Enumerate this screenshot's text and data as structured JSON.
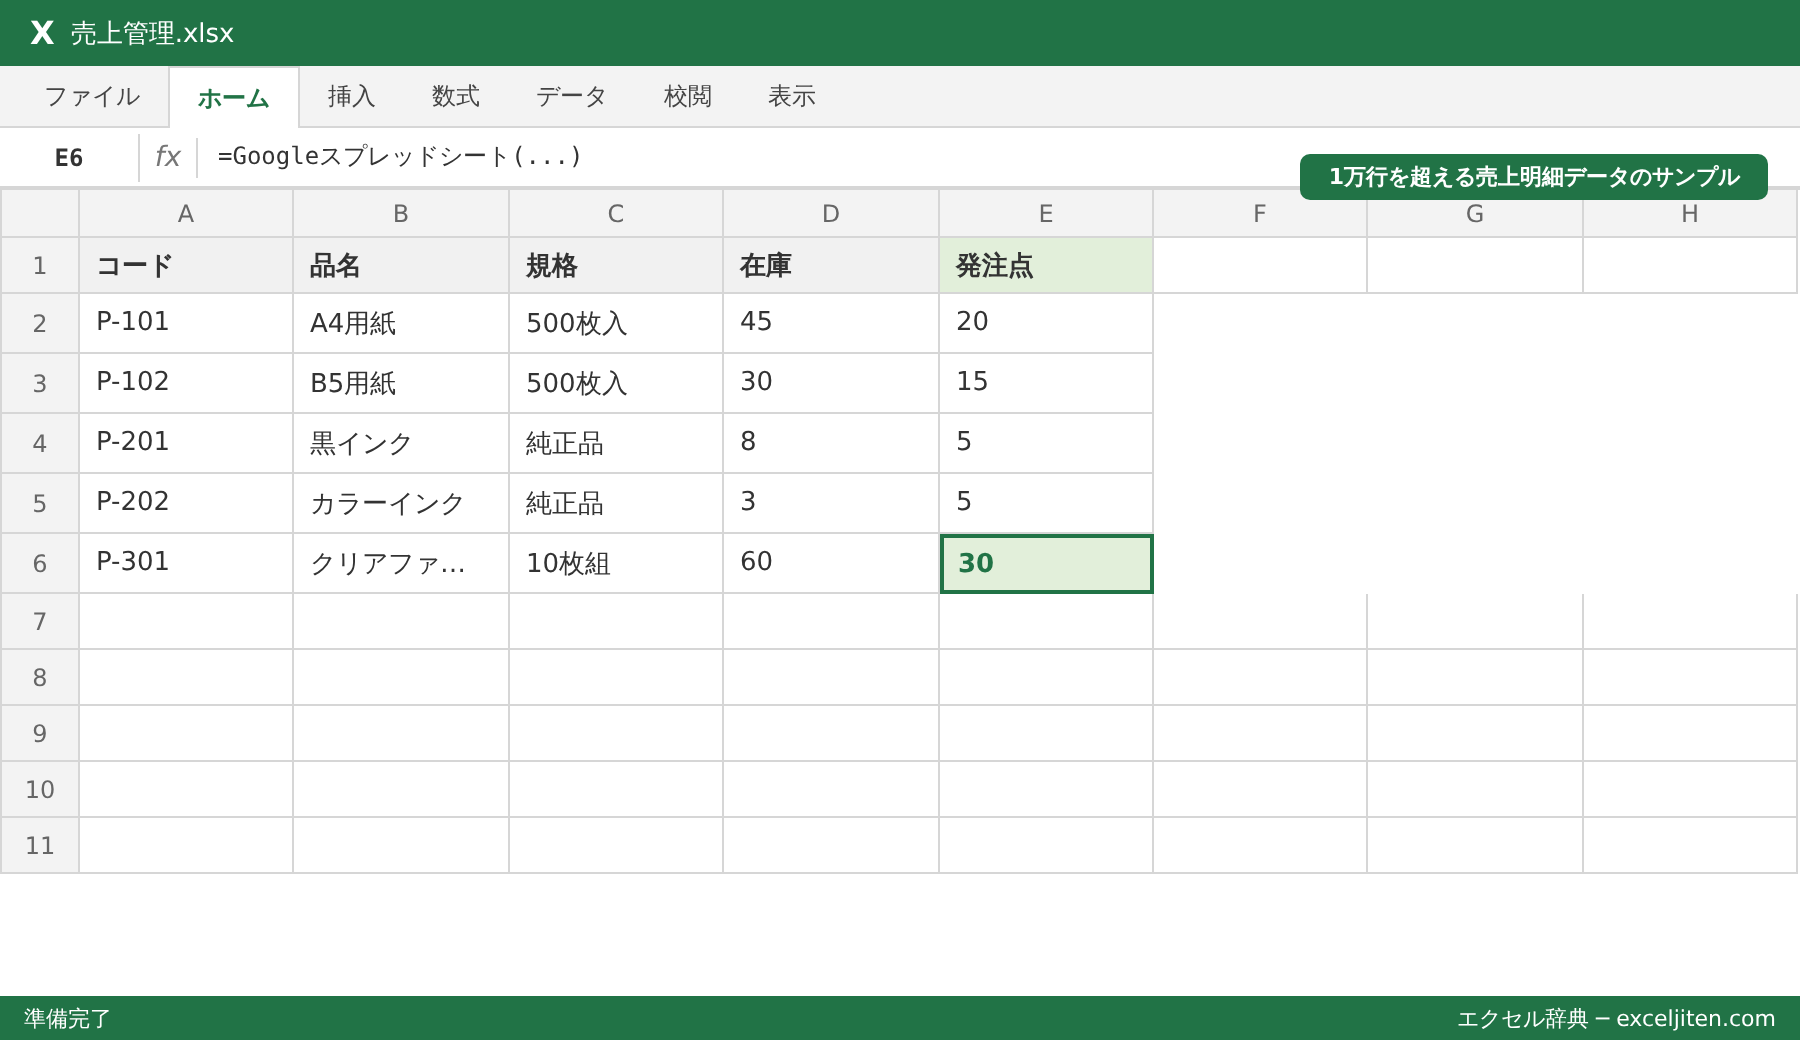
{
  "window": {
    "app_icon": "X",
    "title": "売上管理.xlsx"
  },
  "tabs": [
    {
      "label": "ファイル",
      "selected": false
    },
    {
      "label": "ホーム",
      "selected": true
    },
    {
      "label": "挿入",
      "selected": false
    },
    {
      "label": "数式",
      "selected": false
    },
    {
      "label": "データ",
      "selected": false
    },
    {
      "label": "校閲",
      "selected": false
    },
    {
      "label": "表示",
      "selected": false
    }
  ],
  "formula_bar": {
    "name_box": "E6",
    "fx": "fx",
    "formula": "=Googleスプレッドシート(...)"
  },
  "callout": "1万行を超える売上明細データのサンプル",
  "columns": [
    "A",
    "B",
    "C",
    "D",
    "E",
    "F",
    "G",
    "H"
  ],
  "rows": [
    {
      "number": "1",
      "kind": "header",
      "cells": [
        {
          "text": "コード",
          "highlighted": false,
          "selected": false
        },
        {
          "text": "品名",
          "highlighted": false,
          "selected": false
        },
        {
          "text": "規格",
          "highlighted": false,
          "selected": false
        },
        {
          "text": "在庫",
          "highlighted": false,
          "selected": false
        },
        {
          "text": "発注点",
          "highlighted": true,
          "selected": false
        }
      ]
    },
    {
      "number": "2",
      "kind": "data",
      "cells": [
        {
          "text": "P-101",
          "selected": false
        },
        {
          "text": "A4用紙",
          "selected": false
        },
        {
          "text": "500枚入",
          "selected": false
        },
        {
          "text": "45",
          "selected": false
        },
        {
          "text": "20",
          "selected": false
        }
      ]
    },
    {
      "number": "3",
      "kind": "data",
      "cells": [
        {
          "text": "P-102",
          "selected": false
        },
        {
          "text": "B5用紙",
          "selected": false
        },
        {
          "text": "500枚入",
          "selected": false
        },
        {
          "text": "30",
          "selected": false
        },
        {
          "text": "15",
          "selected": false
        }
      ]
    },
    {
      "number": "4",
      "kind": "data",
      "cells": [
        {
          "text": "P-201",
          "selected": false
        },
        {
          "text": "黒インク",
          "selected": false
        },
        {
          "text": "純正品",
          "selected": false
        },
        {
          "text": "8",
          "selected": false
        },
        {
          "text": "5",
          "selected": false
        }
      ]
    },
    {
      "number": "5",
      "kind": "data",
      "cells": [
        {
          "text": "P-202",
          "selected": false
        },
        {
          "text": "カラーインク",
          "selected": false
        },
        {
          "text": "純正品",
          "selected": false
        },
        {
          "text": "3",
          "selected": false
        },
        {
          "text": "5",
          "selected": false
        }
      ]
    },
    {
      "number": "6",
      "kind": "data",
      "cells": [
        {
          "text": "P-301",
          "selected": false
        },
        {
          "text": "クリアファ…",
          "selected": false
        },
        {
          "text": "10枚組",
          "selected": false
        },
        {
          "text": "60",
          "selected": false
        },
        {
          "text": "30",
          "selected": true
        }
      ]
    },
    {
      "number": "7",
      "kind": "empty"
    },
    {
      "number": "8",
      "kind": "empty"
    },
    {
      "number": "9",
      "kind": "empty"
    },
    {
      "number": "10",
      "kind": "empty"
    },
    {
      "number": "11",
      "kind": "empty"
    }
  ],
  "status_bar": {
    "left": "準備完了",
    "right": "エクセル辞典 ─ exceljiten.com"
  }
}
